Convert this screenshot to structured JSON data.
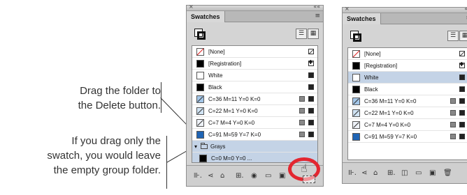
{
  "captions": {
    "drag_folder": [
      "Drag the folder to",
      "the Delete button."
    ],
    "drag_swatch": [
      "If you drag only the",
      "swatch, you would leave",
      "the empty group folder."
    ]
  },
  "panel_before": {
    "title_close": "×",
    "title_collapse": "««",
    "tab": "Swatches",
    "menu_icon": "≡",
    "view_icons": [
      "☰",
      "▦"
    ],
    "swatches": [
      {
        "name": "[None]",
        "chip": "none"
      },
      {
        "name": "[Registration]",
        "chip": "black"
      },
      {
        "name": "White",
        "chip": "white"
      },
      {
        "name": "Black",
        "chip": "black"
      },
      {
        "name": "C=36 M=11 Y=0 K=0",
        "chip": "gradient"
      },
      {
        "name": "C=22 M=1 Y=0 K=0",
        "chip": "gradient"
      },
      {
        "name": "C=7 M=4 Y=0 K=0",
        "chip": "gradient"
      },
      {
        "name": "C=91 M=59 Y=7 K=0",
        "chip": "blue"
      }
    ],
    "group": {
      "name": "Grays",
      "disclosure": "▾",
      "child": "C=0 M=0 Y=0 ..."
    },
    "bottom_icons": [
      "⊪.",
      "⋖",
      "⌂",
      "⊞.",
      "◉",
      "▭",
      "▣"
    ]
  },
  "panel_after": {
    "title_close": "×",
    "title_collapse": "««",
    "tab": "Swatches",
    "menu_icon": "≡",
    "view_icons": [
      "☰",
      "▦"
    ],
    "swatches": [
      {
        "name": "[None]",
        "chip": "none"
      },
      {
        "name": "[Registration]",
        "chip": "black"
      },
      {
        "name": "White",
        "chip": "white"
      },
      {
        "name": "Black",
        "chip": "black"
      },
      {
        "name": "C=36 M=11 Y=0 K=0",
        "chip": "gradient"
      },
      {
        "name": "C=22 M=1 Y=0 K=0",
        "chip": "gradient"
      },
      {
        "name": "C=7 M=4 Y=0 K=0",
        "chip": "gradient"
      },
      {
        "name": "C=91 M=59 Y=7 K=0",
        "chip": "blue"
      }
    ],
    "bottom_icons": [
      "⊪.",
      "⋖",
      "⌂",
      "⊞.",
      "◫",
      "▭",
      "▣",
      "🗑"
    ]
  },
  "colors": {
    "highlight_ring": "#e32630",
    "selection": "#c4d3e6",
    "blue_swatch": "#1f64b4",
    "light_blue_swatch": "#a3c6e8"
  }
}
